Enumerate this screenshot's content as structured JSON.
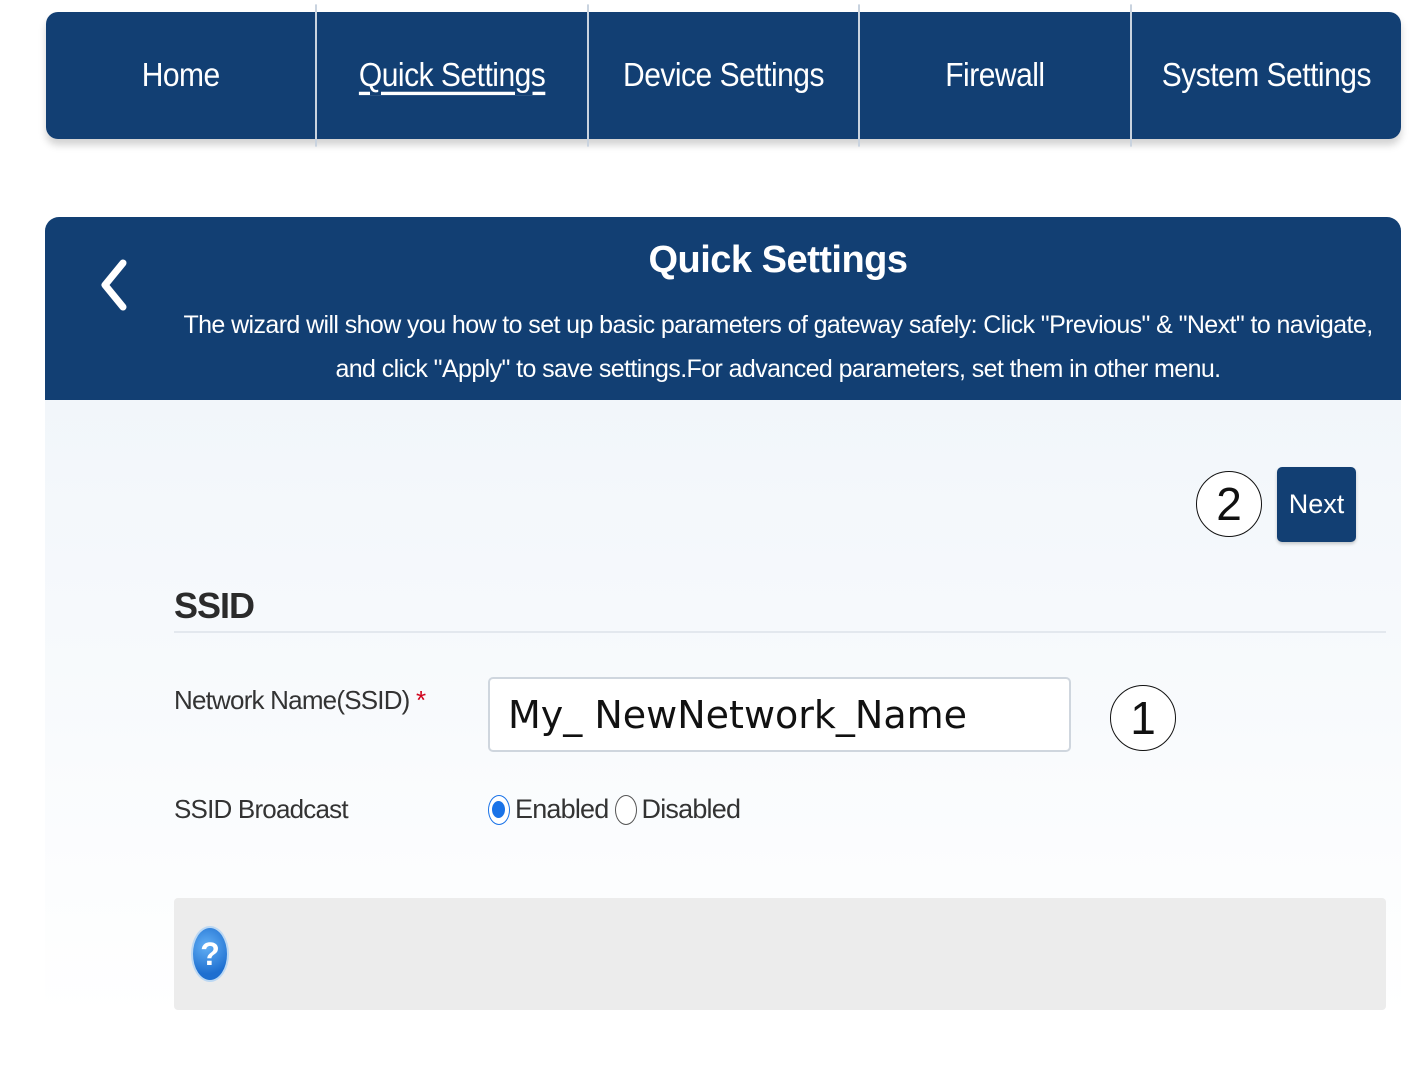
{
  "nav": {
    "items": [
      {
        "label": "Home"
      },
      {
        "label": "Quick Settings"
      },
      {
        "label": "Device Settings"
      },
      {
        "label": "Firewall"
      },
      {
        "label": "System Settings"
      }
    ],
    "active": "Quick Settings"
  },
  "panel": {
    "back_icon": "chevron-left-icon",
    "title": "Quick Settings",
    "description": "The wizard will show you how to set up basic parameters of gateway safely: Click \"Previous\" & \"Next\" to navigate, and click \"Apply\" to save settings.For advanced parameters, set them in other menu."
  },
  "wizard": {
    "next_label": "Next",
    "step_markers": {
      "input": "1",
      "next": "2"
    }
  },
  "ssid": {
    "heading": "SSID",
    "network_name_label": "Network Name(SSID)",
    "required_mark": "*",
    "network_name_value": "My_ NewNetwork_Name",
    "broadcast_label": "SSID Broadcast",
    "broadcast_options": [
      "Enabled",
      "Disabled"
    ],
    "broadcast_selected": "Enabled"
  },
  "help": {
    "icon": "help-icon",
    "icon_glyph": "?"
  },
  "colors": {
    "primary": "#123f73",
    "radio_selected": "#1a73e8",
    "required": "#d0021b"
  }
}
